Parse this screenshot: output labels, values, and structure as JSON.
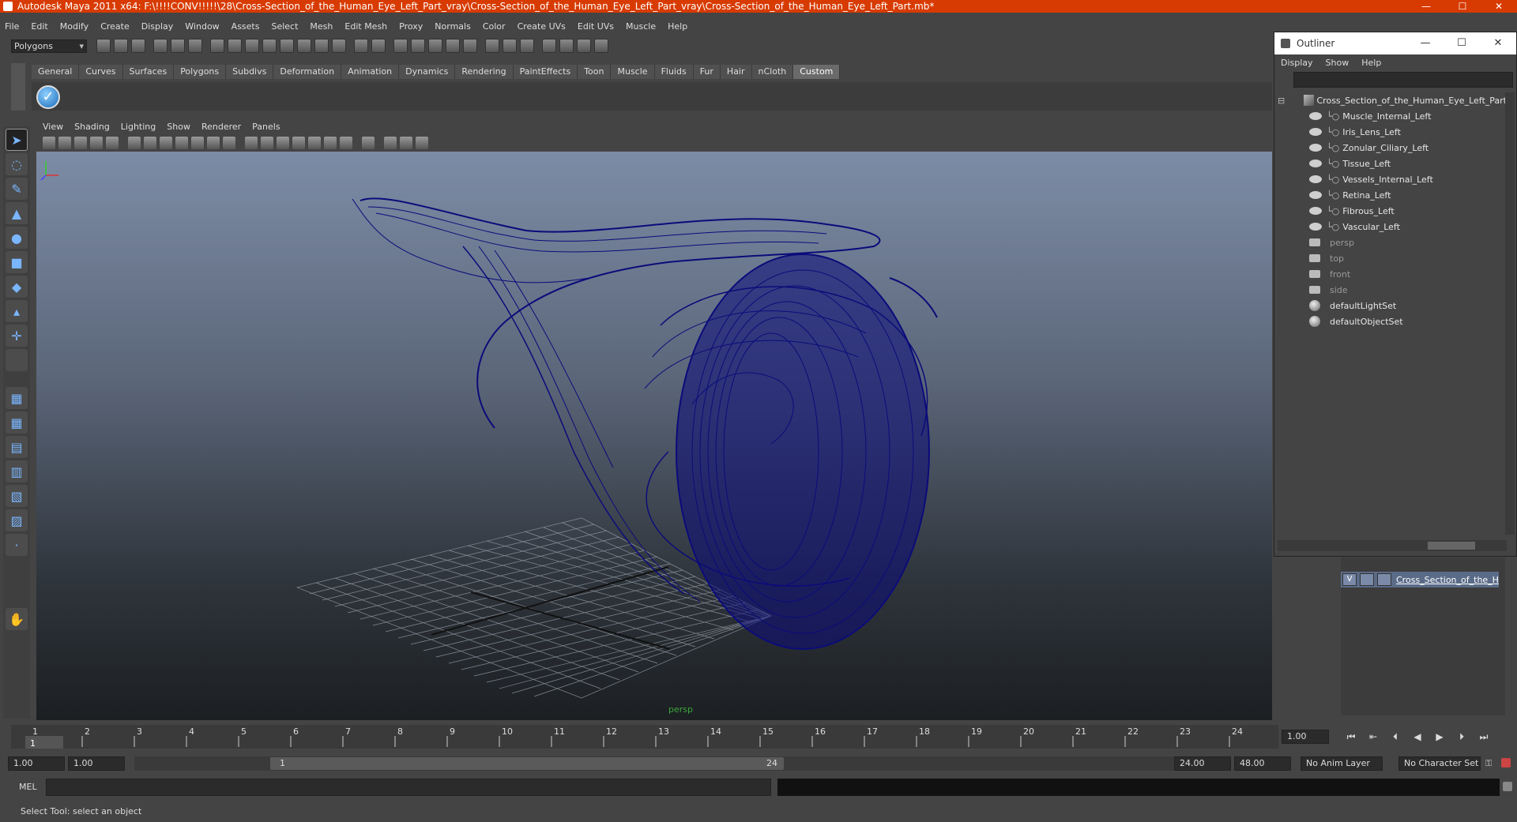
{
  "window": {
    "title": "Autodesk Maya 2011 x64: F:\\!!!!CONV!!!!!\\28\\Cross-Section_of_the_Human_Eye_Left_Part_vray\\Cross-Section_of_the_Human_Eye_Left_Part_vray\\Cross-Section_of_the_Human_Eye_Left_Part.mb*",
    "minimize": "—",
    "maximize": "☐",
    "close": "✕"
  },
  "menubar": [
    "File",
    "Edit",
    "Modify",
    "Create",
    "Display",
    "Window",
    "Assets",
    "Select",
    "Mesh",
    "Edit Mesh",
    "Proxy",
    "Normals",
    "Color",
    "Create UVs",
    "Edit UVs",
    "Muscle",
    "Help"
  ],
  "statusline": {
    "mode": "Polygons"
  },
  "shelf": {
    "tabs": [
      "General",
      "Curves",
      "Surfaces",
      "Polygons",
      "Subdivs",
      "Deformation",
      "Animation",
      "Dynamics",
      "Rendering",
      "PaintEffects",
      "Toon",
      "Muscle",
      "Fluids",
      "Fur",
      "Hair",
      "nCloth",
      "Custom"
    ],
    "active_tab": "Custom"
  },
  "panel": {
    "menus": [
      "View",
      "Shading",
      "Lighting",
      "Show",
      "Renderer",
      "Panels"
    ],
    "camera_label": "persp"
  },
  "outliner": {
    "title": "Outliner",
    "menus": [
      "Display",
      "Show",
      "Help"
    ],
    "root": "Cross_Section_of_the_Human_Eye_Left_Part",
    "children": [
      "Muscle_Internal_Left",
      "Iris_Lens_Left",
      "Zonular_Ciliary_Left",
      "Tissue_Left",
      "Vessels_Internal_Left",
      "Retina_Left",
      "Fibrous_Left",
      "Vascular_Left"
    ],
    "cameras": [
      "persp",
      "top",
      "front",
      "side"
    ],
    "sets": [
      "defaultLightSet",
      "defaultObjectSet"
    ]
  },
  "layers": {
    "visible_flag": "V",
    "layer_name": "Cross_Section_of_the_H"
  },
  "timeslider": {
    "ticks": [
      "1",
      "2",
      "3",
      "4",
      "5",
      "6",
      "7",
      "8",
      "9",
      "10",
      "11",
      "12",
      "13",
      "14",
      "15",
      "16",
      "17",
      "18",
      "19",
      "20",
      "21",
      "22",
      "23",
      "24"
    ],
    "current_frame": "1.00",
    "current_frame_marker": "1"
  },
  "range": {
    "start_a": "1.00",
    "start_b": "1.00",
    "handle_start": "1",
    "handle_end": "24",
    "end_a": "24.00",
    "end_b": "48.00",
    "anim_layer": "No Anim Layer",
    "char_set": "No Character Set"
  },
  "command": {
    "label": "MEL"
  },
  "help_line": "Select Tool: select an object",
  "colors": {
    "title_bar": "#d83b01",
    "wireframe": "#0b0b7a",
    "layer_row": "#5a6b88"
  }
}
